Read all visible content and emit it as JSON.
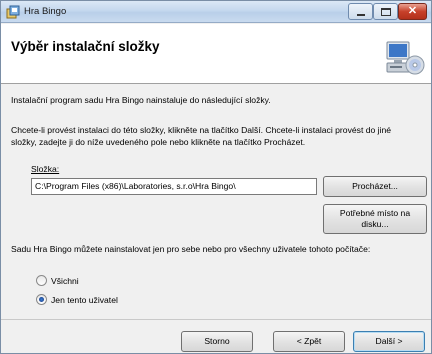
{
  "window": {
    "title": "Hra Bingo",
    "close_glyph": "✕"
  },
  "header": {
    "title": "Výběr instalační složky"
  },
  "body": {
    "line1": "Instalační program sadu Hra Bingo nainstaluje do následující složky.",
    "line2a": "Chcete-li provést instalaci do této složky, klikněte na tlačítko Další. Chcete-li instalaci provést do jiné",
    "line2b": "složky, zadejte ji do níže uvedeného pole nebo klikněte na tlačítko Procházet."
  },
  "folder": {
    "label": "Složka:",
    "value": "C:\\Program Files (x86)\\Laboratories, s.r.o\\Hra Bingo\\",
    "browse_label": "Procházet...",
    "space_label_1": "Potřebné místo na",
    "space_label_2": "disku..."
  },
  "install_for": {
    "text": "Sadu Hra Bingo můžete nainstalovat jen pro sebe nebo pro všechny uživatele tohoto počítače:",
    "options": [
      {
        "label": "Všichni",
        "checked": false
      },
      {
        "label": "Jen tento uživatel",
        "checked": true
      }
    ]
  },
  "footer": {
    "cancel_label": "Storno",
    "back_label": "< Zpět",
    "next_label": "Další >"
  },
  "colors": {
    "titlebar": "#c5d8ee",
    "default_button_border": "#3c7fb1"
  }
}
